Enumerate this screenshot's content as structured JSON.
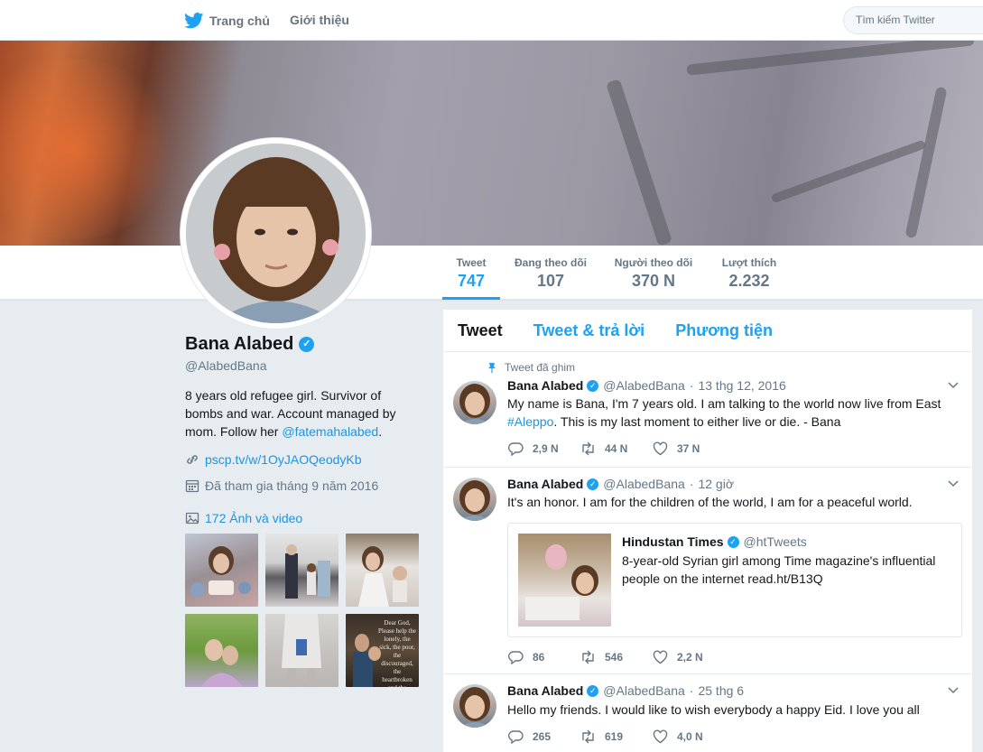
{
  "nav": {
    "home_label": "Trang chủ",
    "about_label": "Giới thiệu",
    "search_placeholder": "Tìm kiếm Twitter"
  },
  "stats": [
    {
      "label": "Tweet",
      "value": "747"
    },
    {
      "label": "Đang theo dõi",
      "value": "107"
    },
    {
      "label": "Người theo dõi",
      "value": "370 N"
    },
    {
      "label": "Lượt thích",
      "value": "2.232"
    }
  ],
  "profile": {
    "name": "Bana Alabed",
    "handle": "@AlabedBana",
    "bio_text": "8 years old refugee girl. Survivor of bombs and war. Account managed by mom. Follow her ",
    "bio_link": "@fatemahalabed",
    "bio_end": ".",
    "url": "pscp.tv/w/1OyJAOQeodyKb",
    "joined": "Đã tham gia tháng 9 năm 2016",
    "media_label": "172 Ảnh và video",
    "thumb_quote": "Dear God, Please help the lonely, the sick, the poor, the discouraged, the heartbroken and the helpless. Amen"
  },
  "tabs": [
    "Tweet",
    "Tweet & trả lời",
    "Phương tiện"
  ],
  "tweets": [
    {
      "pinned_label": "Tweet đã ghim",
      "name": "Bana Alabed",
      "handle": "@AlabedBana",
      "time": "13 thg 12, 2016",
      "text_1": "My name is Bana, I'm 7 years old. I am talking to the world now live from East ",
      "hashtag": "#Aleppo",
      "text_2": ". This is my last moment to either live or die. - Bana",
      "replies": "2,9 N",
      "retweets": "44 N",
      "likes": "37 N"
    },
    {
      "name": "Bana Alabed",
      "handle": "@AlabedBana",
      "time": "12 giờ",
      "text": "It's an honor. I am for the children of the world, I am for a peaceful world.",
      "card": {
        "name": "Hindustan Times",
        "handle": "@htTweets",
        "text": "8-year-old Syrian girl among Time magazine's influential people on the internet read.ht/B13Q"
      },
      "replies": "86",
      "retweets": "546",
      "likes": "2,2 N"
    },
    {
      "name": "Bana Alabed",
      "handle": "@AlabedBana",
      "time": "25 thg 6",
      "text": "Hello my friends. I would like to wish everybody a happy Eid. I love you all",
      "replies": "265",
      "retweets": "619",
      "likes": "4,0 N"
    }
  ],
  "colors": {
    "accent": "#1da1f2",
    "link": "#1b95e0",
    "muted": "#657786",
    "background": "#e6ecf0"
  },
  "icons": [
    "twitter-bird-icon",
    "verified-icon",
    "link-icon",
    "calendar-icon",
    "image-icon",
    "pin-icon",
    "caret-down-icon",
    "reply-icon",
    "retweet-icon",
    "like-icon"
  ]
}
